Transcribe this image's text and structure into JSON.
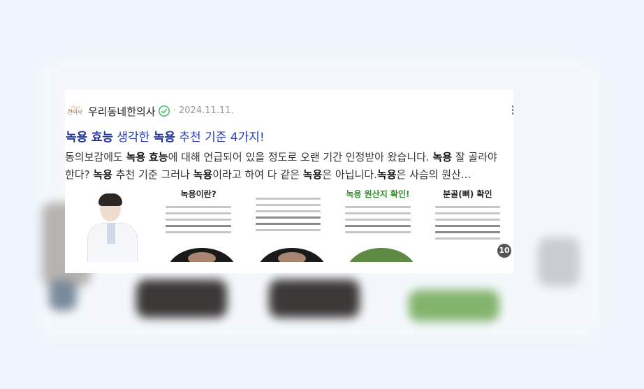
{
  "post": {
    "blog_logo_text": "한의사",
    "blog_logo_small": "우리동네",
    "blog_name": "우리동네한의사",
    "verified_icon": "verified-check-icon",
    "separator": "·",
    "date": "2024.11.11.",
    "more_icon": "more-vertical-icon",
    "title_parts": [
      "녹용",
      " ",
      "효능",
      " 생각한 ",
      "녹용",
      " 추천 기준 4가지!"
    ],
    "snippet_parts": [
      "동의보감에도 ",
      "녹용",
      " ",
      "효능",
      "에 대해 언급되어 있을 정도로 오랜 기간 인정받아 왔습니다. ",
      "녹용",
      " 잘 골라야 한다? ",
      "녹용",
      " 추천 기준 그러나 ",
      "녹용",
      "이라고 하여 다 같은 ",
      "녹용",
      "은 아닙니다.",
      "녹용",
      "은 사슴의 원산..."
    ],
    "image_count": "10",
    "thumbnails": [
      {
        "heading": ""
      },
      {
        "heading": "녹용이란?"
      },
      {
        "heading": ""
      },
      {
        "heading": "녹용 원산지 확인!"
      },
      {
        "heading": "분골(뼈) 확인"
      }
    ]
  },
  "colors": {
    "title": "#2b3fb5",
    "verified": "#3dbf6c",
    "badge": "#555555"
  }
}
